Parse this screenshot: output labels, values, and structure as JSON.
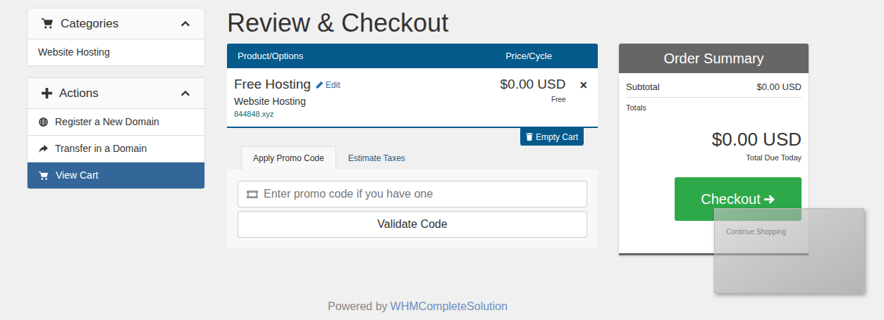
{
  "sidebar": {
    "panels": [
      {
        "title": "Categories",
        "expanded": true,
        "items": [
          {
            "label": "Website Hosting",
            "selected": false
          }
        ]
      },
      {
        "title": "Actions",
        "expanded": true,
        "items": [
          {
            "label": "Register a New Domain",
            "selected": false
          },
          {
            "label": "Transfer in a Domain",
            "selected": false
          },
          {
            "label": "View Cart",
            "selected": true
          }
        ]
      }
    ]
  },
  "page_title": "Review & Checkout",
  "cart": {
    "columns": [
      "Product/Options",
      "Price/Cycle"
    ],
    "items": [
      {
        "name": "Free Hosting",
        "edit": "Edit",
        "group": "Website Hosting",
        "domain": "844848.xyz",
        "price": "$0.00 USD",
        "cycle": "Free",
        "remove": "×"
      }
    ],
    "empty_button": "Empty Cart"
  },
  "tabs": [
    {
      "label": "Apply Promo Code",
      "selected": true
    },
    {
      "label": "Estimate Taxes",
      "selected": false
    }
  ],
  "promo": {
    "placeholder": "Enter promo code if you have one",
    "button": "Validate Code"
  },
  "summary": {
    "title": "Order Summary",
    "subtotal_label": "Subtotal",
    "subtotal": "$0.00 USD",
    "totals_label": "Totals",
    "total": "$0.00 USD",
    "total_caption": "Total Due Today",
    "checkout": "Checkout",
    "continue": "Continue Shopping"
  },
  "footer": {
    "prefix": "Powered by",
    "link": "WHMCompleteSolution"
  }
}
